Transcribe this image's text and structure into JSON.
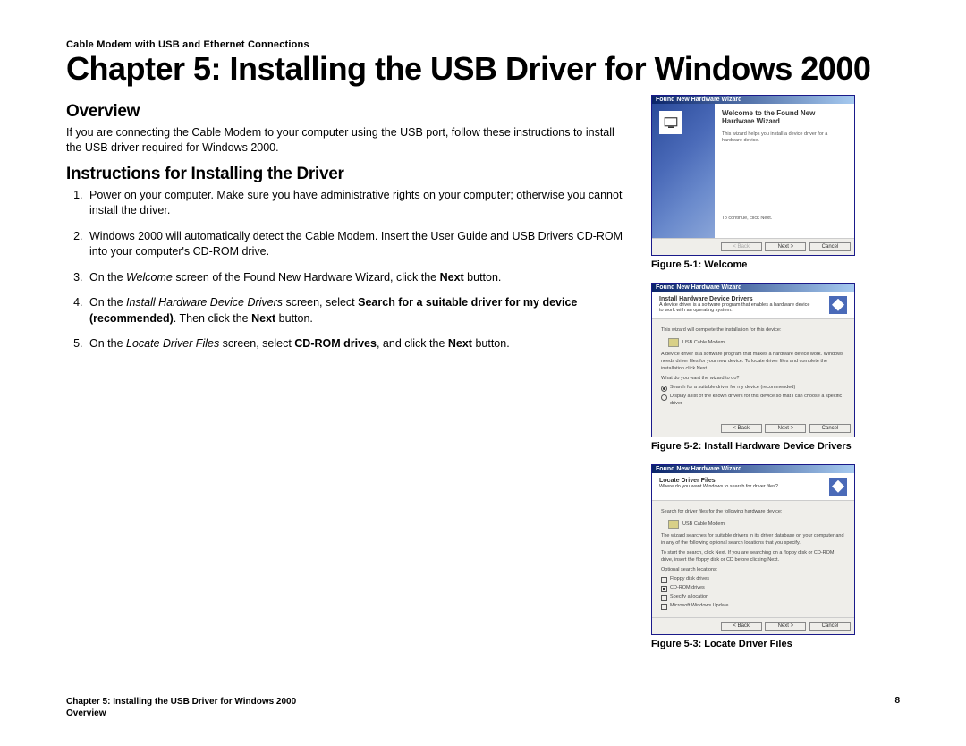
{
  "header": "Cable Modem with USB and Ethernet Connections",
  "chapter_title": "Chapter 5: Installing the USB Driver for Windows 2000",
  "sections": {
    "overview": {
      "heading": "Overview",
      "text": "If you are connecting the Cable Modem to your computer using the USB port, follow these instructions to install the USB driver required for Windows 2000."
    },
    "instructions": {
      "heading": "Instructions for Installing the Driver",
      "steps": [
        {
          "plain": "Power on your computer. Make sure you have administrative rights on your computer; otherwise you cannot install the driver."
        },
        {
          "plain": "Windows 2000 will automatically detect the Cable Modem. Insert the User Guide and USB Drivers CD-ROM into your computer's CD-ROM drive."
        },
        {
          "prefix": "On the ",
          "ital1": "Welcome",
          "mid1": " screen of the Found New Hardware Wizard, click the ",
          "bold1": "Next",
          "suffix": " button."
        },
        {
          "prefix": "On the ",
          "ital1": "Install Hardware Device Drivers",
          "mid1": " screen, select ",
          "bold1": "Search for a suitable driver for my device (recommended)",
          "mid2": ". Then click the ",
          "bold2": "Next",
          "suffix": " button."
        },
        {
          "prefix": "On the ",
          "ital1": "Locate Driver Files",
          "mid1": " screen, select ",
          "bold1": "CD-ROM drives",
          "mid2": ", and click the ",
          "bold2": "Next",
          "suffix": " button."
        }
      ]
    }
  },
  "figures": {
    "fig1": {
      "window_title": "Found New Hardware Wizard",
      "heading": "Welcome to the Found New Hardware Wizard",
      "body": "This wizard helps you install a device driver for a hardware device.",
      "continue_text": "To continue, click Next.",
      "buttons": {
        "back": "< Back",
        "next": "Next >",
        "cancel": "Cancel"
      },
      "caption": "Figure 5-1: Welcome"
    },
    "fig2": {
      "window_title": "Found New Hardware Wizard",
      "top_bold": "Install Hardware Device Drivers",
      "top_sub": "A device driver is a software program that enables a hardware device to work with an operating system.",
      "line1": "This wizard will complete the installation for this device:",
      "device": "USB Cable Modem",
      "para": "A device driver is a software program that makes a hardware device work. Windows needs driver files for your new device. To locate driver files and complete the installation click Next.",
      "question": "What do you want the wizard to do?",
      "opt1": "Search for a suitable driver for my device (recommended)",
      "opt2": "Display a list of the known drivers for this device so that I can choose a specific driver",
      "buttons": {
        "back": "< Back",
        "next": "Next >",
        "cancel": "Cancel"
      },
      "caption": "Figure 5-2: Install Hardware Device Drivers"
    },
    "fig3": {
      "window_title": "Found New Hardware Wizard",
      "top_bold": "Locate Driver Files",
      "top_sub": "Where do you want Windows to search for driver files?",
      "line1": "Search for driver files for the following hardware device:",
      "device": "USB Cable Modem",
      "para1": "The wizard searches for suitable drivers in its driver database on your computer and in any of the following optional search locations that you specify.",
      "para2": "To start the search, click Next. If you are searching on a floppy disk or CD-ROM drive, insert the floppy disk or CD before clicking Next.",
      "opt_label": "Optional search locations:",
      "opt1": "Floppy disk drives",
      "opt2": "CD-ROM drives",
      "opt3": "Specify a location",
      "opt4": "Microsoft Windows Update",
      "buttons": {
        "back": "< Back",
        "next": "Next >",
        "cancel": "Cancel"
      },
      "caption": "Figure 5-3: Locate Driver Files"
    }
  },
  "footer": {
    "line1": "Chapter 5: Installing the USB Driver for Windows 2000",
    "line2": "Overview",
    "page_number": "8"
  }
}
